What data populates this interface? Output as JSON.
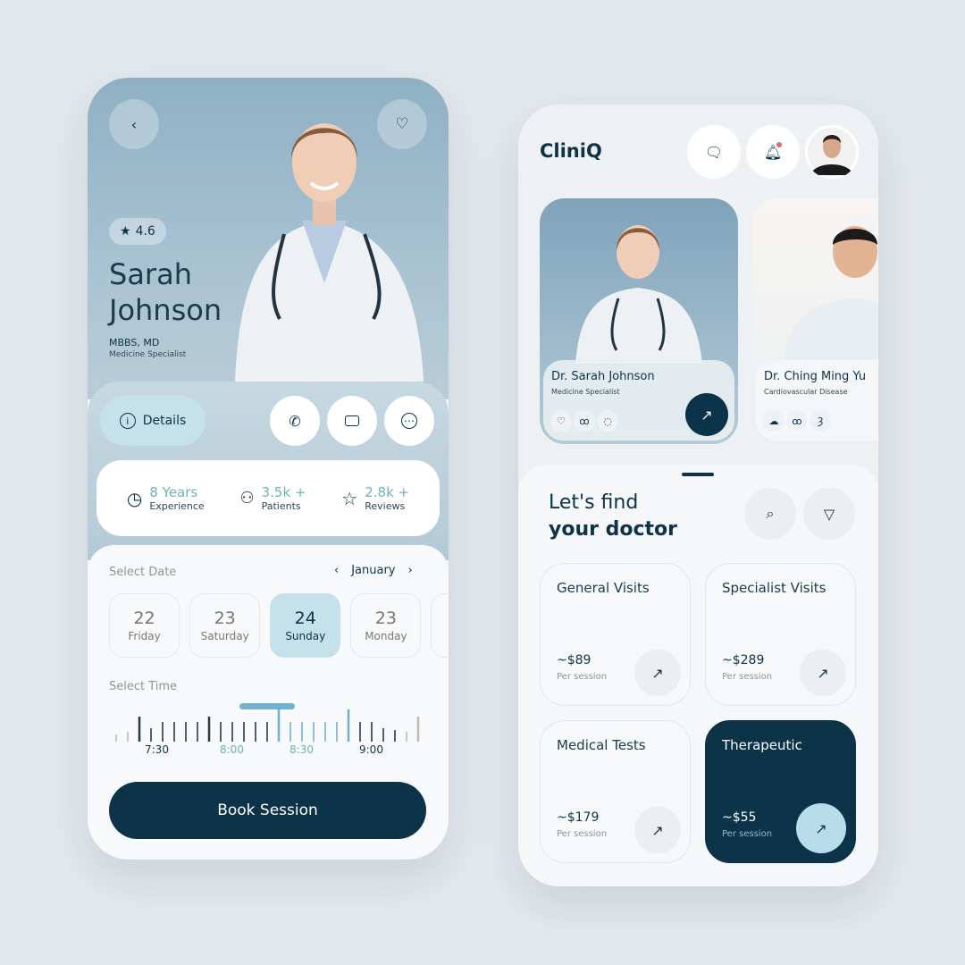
{
  "profile": {
    "rating": "4.6",
    "first_name": "Sarah",
    "last_name": "Johnson",
    "degree": "MBBS, MD",
    "specialty": "Medicine Specialist",
    "details_label": "Details",
    "stats": [
      {
        "value": "8 Years",
        "label": "Experience",
        "icon": "clock-icon"
      },
      {
        "value": "3.5k +",
        "label": "Patients",
        "icon": "users-icon"
      },
      {
        "value": "2.8k +",
        "label": "Reviews",
        "icon": "star-icon"
      }
    ],
    "select_date_label": "Select Date",
    "month": "January",
    "dates": [
      {
        "day": "22",
        "weekday": "Friday"
      },
      {
        "day": "23",
        "weekday": "Saturday"
      },
      {
        "day": "24",
        "weekday": "Sunday",
        "selected": true
      },
      {
        "day": "23",
        "weekday": "Monday"
      }
    ],
    "select_time_label": "Select Time",
    "time_labels": [
      "7:30",
      "8:00",
      "8:30",
      "9:00"
    ],
    "selected_range": [
      "8:00",
      "8:30"
    ],
    "book_label": "Book Session"
  },
  "home": {
    "logo": "CliniQ",
    "doctors": [
      {
        "name": "Dr. Sarah Johnson",
        "specialty": "Medicine Specialist",
        "icons": [
          "heart-icon",
          "lungs-icon",
          "kidney-icon"
        ]
      },
      {
        "name": "Dr. Ching Ming Yu",
        "specialty": "Cardiovascular Disease",
        "icons": [
          "brain-icon",
          "kidneys-icon",
          "stomach-icon"
        ]
      }
    ],
    "heading_line1": "Let's find",
    "heading_line2": "your doctor",
    "services": [
      {
        "title": "General Visits",
        "price": "~$89",
        "unit": "Per session"
      },
      {
        "title": "Specialist Visits",
        "price": "~$289",
        "unit": "Per session"
      },
      {
        "title": "Medical Tests",
        "price": "~$179",
        "unit": "Per session"
      },
      {
        "title": "Therapeutic",
        "price": "~$55",
        "unit": "Per session",
        "active": true
      }
    ]
  },
  "colors": {
    "primary": "#0d3349",
    "accent": "#6fb1b9",
    "selected": "#c4e1ec",
    "notification": "#e06a7a"
  }
}
